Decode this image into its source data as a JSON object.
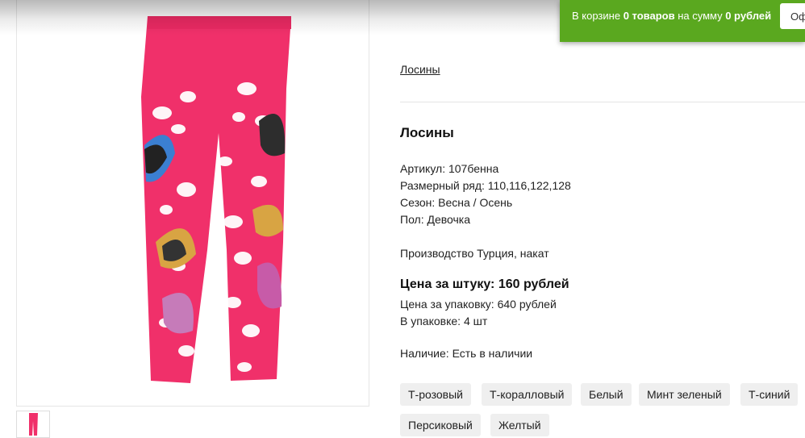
{
  "cart": {
    "prefix": "В корзине ",
    "count": "0 товаров",
    "middle": " на сумму ",
    "sum": "0 рублей",
    "button_label": "Оф"
  },
  "colors": {
    "cart_green": "#5aa81f",
    "legging_pink": "#f0306a",
    "chip_bg": "#efefef"
  },
  "thumbnails": [
    {
      "name": "thumb-turquoise",
      "bg": "#3fc3cf",
      "accent": "#f25c9b"
    },
    {
      "name": "thumb-light-blue",
      "bg": "#d6ecf8",
      "accent": "#d9a42e"
    },
    {
      "name": "thumb-pink",
      "bg": "#f6a9d2",
      "accent": "#c03d8a"
    },
    {
      "name": "thumb-hot-pink",
      "bg": "#f0408f",
      "accent": "#ffffff"
    },
    {
      "name": "thumb-yellow",
      "bg": "#f3eeb4",
      "accent": "#e65fa7"
    },
    {
      "name": "thumb-navy",
      "bg": "#172a5a",
      "accent": "#ffffff"
    },
    {
      "name": "thumb-light-pink",
      "bg": "#f9c9df",
      "accent": "#d08a2f"
    }
  ],
  "breadcrumb": "Лосины",
  "product": {
    "title": "Лосины",
    "article": "Артикул: 107бенна",
    "sizes": "Размерный ряд: 110,116,122,128",
    "season": "Сезон: Весна / Осень",
    "gender": "Пол: Девочка",
    "production": "Производство Турция, накат",
    "price_unit": "Цена за штуку: 160 рублей",
    "price_pack": "Цена за упаковку: 640 рублей",
    "pack_qty": "В упаковке: 4 шт",
    "availability": "Наличие: Есть в наличии"
  },
  "color_options": [
    "Т-розовый",
    "Т-коралловый",
    "Белый",
    "Минт зеленый",
    "Т-синий",
    "Персиковый",
    "Желтый"
  ]
}
